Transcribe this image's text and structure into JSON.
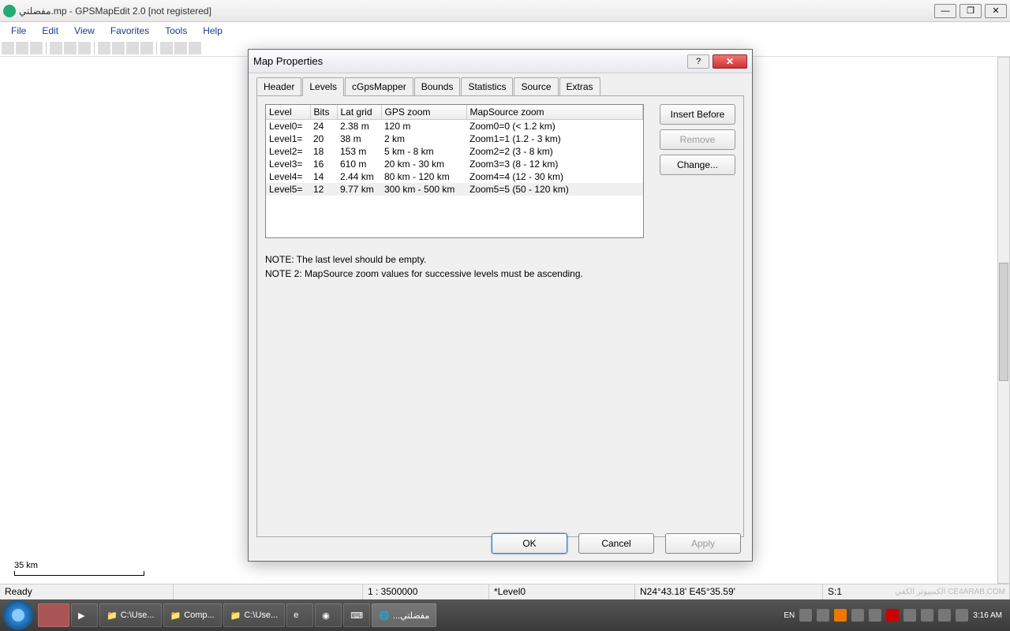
{
  "window": {
    "title": "مفضلتي.mp - GPSMapEdit 2.0 [not registered]"
  },
  "menu": [
    "File",
    "Edit",
    "View",
    "Favorites",
    "Tools",
    "Help"
  ],
  "dialog": {
    "title": "Map Properties",
    "tabs": [
      "Header",
      "Levels",
      "cGpsMapper",
      "Bounds",
      "Statistics",
      "Source",
      "Extras"
    ],
    "active_tab": "Levels",
    "columns": [
      "Level",
      "Bits",
      "Lat grid",
      "GPS zoom",
      "MapSource zoom"
    ],
    "rows": [
      {
        "level": "Level0=",
        "bits": "24",
        "lat": "2.38 m",
        "gps": "120 m",
        "ms": "Zoom0=0 (< 1.2 km)"
      },
      {
        "level": "Level1=",
        "bits": "20",
        "lat": "38 m",
        "gps": "2 km",
        "ms": "Zoom1=1 (1.2 - 3 km)"
      },
      {
        "level": "Level2=",
        "bits": "18",
        "lat": "153 m",
        "gps": "5 km - 8 km",
        "ms": "Zoom2=2 (3 - 8 km)"
      },
      {
        "level": "Level3=",
        "bits": "16",
        "lat": "610 m",
        "gps": "20 km - 30 km",
        "ms": "Zoom3=3 (8 - 12 km)"
      },
      {
        "level": "Level4=",
        "bits": "14",
        "lat": "2.44 km",
        "gps": "80 km - 120 km",
        "ms": "Zoom4=4 (12 - 30 km)"
      },
      {
        "level": "Level5=",
        "bits": "12",
        "lat": "9.77 km",
        "gps": "300 km - 500 km",
        "ms": "Zoom5=5 (50 - 120 km)"
      }
    ],
    "selected_row": 5,
    "side_buttons": {
      "insert": "Insert Before",
      "remove": "Remove",
      "change": "Change..."
    },
    "note1": "NOTE: The last level should be empty.",
    "note2": "NOTE 2: MapSource zoom values for successive levels must be ascending.",
    "ok": "OK",
    "cancel": "Cancel",
    "apply": "Apply"
  },
  "status": {
    "ready": "Ready",
    "scale": "1 : 3500000",
    "level": "*Level0",
    "coords": "N24°43.18' E45°35.59'",
    "s": "S:1"
  },
  "scalebar": "35 km",
  "taskbar": {
    "items": [
      "C:\\Use...",
      "Comp...",
      "C:\\Use...",
      "",
      "",
      "",
      "...مفضلتي"
    ],
    "lang": "EN",
    "time": "3:16 AM"
  },
  "watermark": "الكمبيوتر الكفي\nCE4ARAB.COM"
}
